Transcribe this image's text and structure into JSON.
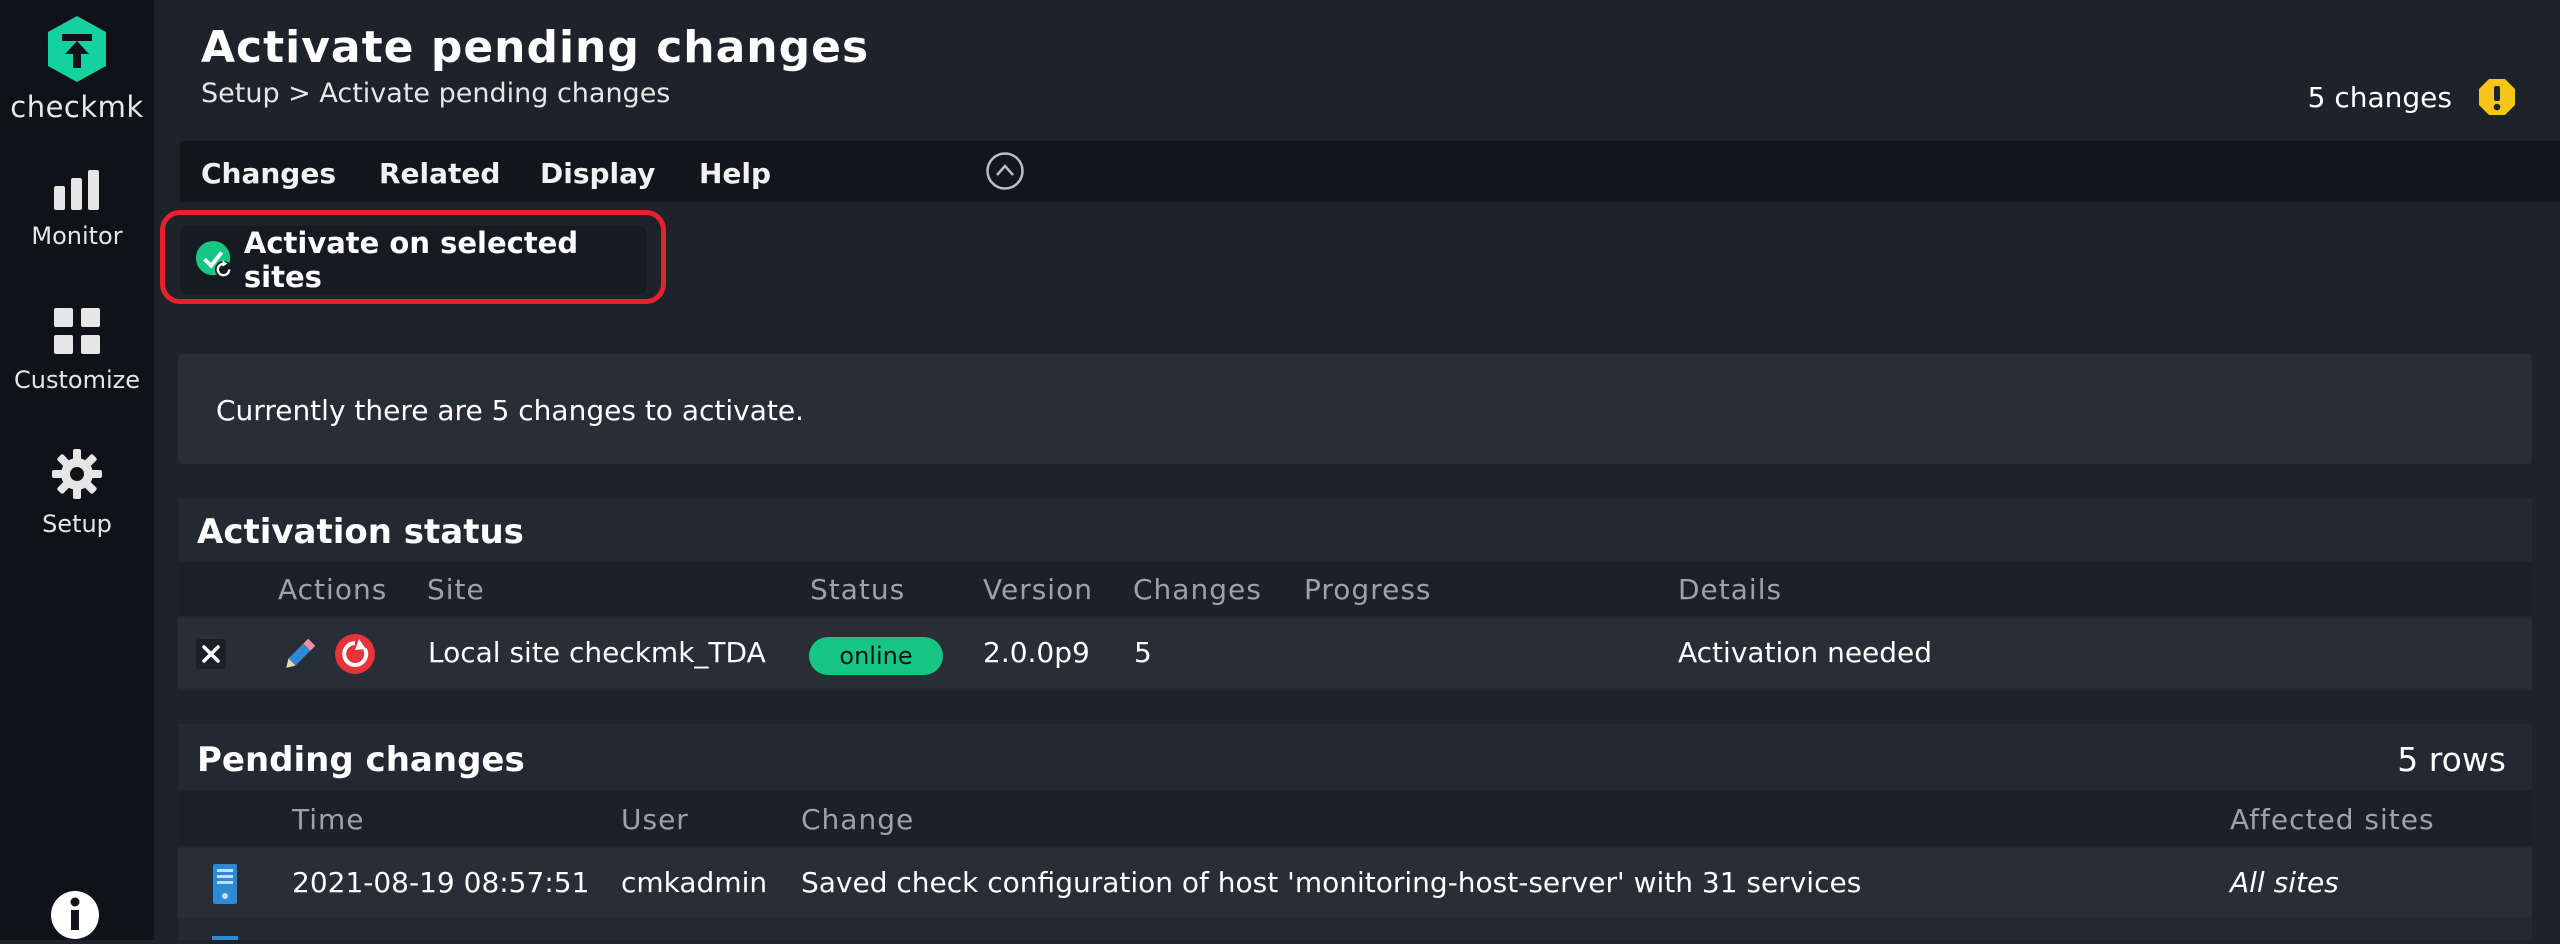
{
  "app": {
    "logo_text": "checkmk",
    "brand_color": "#15d1a0"
  },
  "sidebar": {
    "items": [
      {
        "label": "Monitor",
        "icon": "bar-chart-icon"
      },
      {
        "label": "Customize",
        "icon": "grid-icon"
      },
      {
        "label": "Setup",
        "icon": "gear-icon"
      }
    ],
    "info_icon": "info-icon"
  },
  "header": {
    "title": "Activate pending changes",
    "breadcrumb": "Setup > Activate pending changes",
    "changes_label": "5 changes",
    "warning_color": "#f5c518"
  },
  "menu": {
    "items": [
      "Changes",
      "Related",
      "Display",
      "Help"
    ]
  },
  "toolbar": {
    "activate_label": "Activate on selected sites",
    "highlight_color": "#e8202d"
  },
  "info": {
    "message": "Currently there are 5 changes to activate."
  },
  "activation_status": {
    "title": "Activation status",
    "columns": [
      "Actions",
      "Site",
      "Status",
      "Version",
      "Changes",
      "Progress",
      "Details"
    ],
    "rows": [
      {
        "site": "Local site checkmk_TDA",
        "status": "online",
        "version": "2.0.0p9",
        "changes": "5",
        "progress": "",
        "details": "Activation needed"
      }
    ],
    "status_color": "#16c784"
  },
  "pending_changes": {
    "title": "Pending changes",
    "rows_count": "5 rows",
    "columns": [
      "Time",
      "User",
      "Change",
      "Affected sites"
    ],
    "rows": [
      {
        "time": "2021-08-19 08:57:51",
        "user": "cmkadmin",
        "change": "Saved check configuration of host 'monitoring-host-server' with 31 services",
        "affected_sites": "All sites"
      }
    ]
  }
}
